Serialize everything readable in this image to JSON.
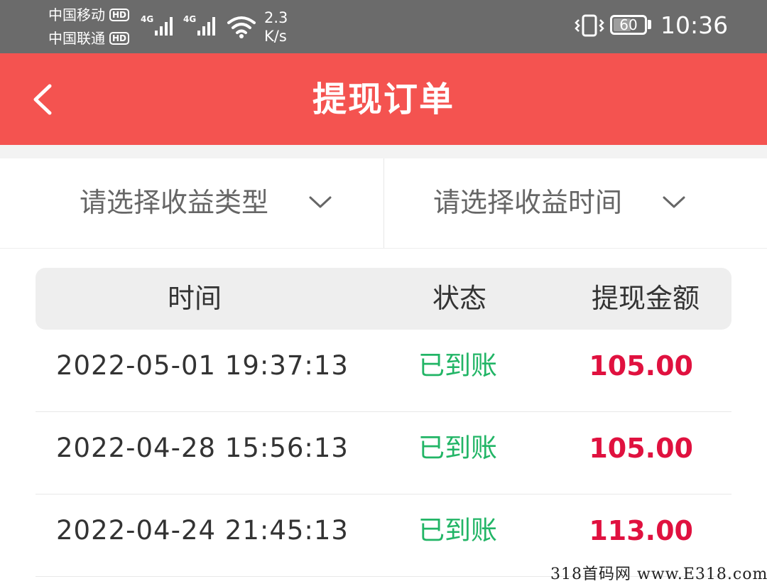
{
  "status_bar": {
    "carrier1": "中国移动",
    "carrier2": "中国联通",
    "hd_badge": "HD",
    "network1": "4G",
    "network2": "4G",
    "speed_value": "2.3",
    "speed_unit": "K/s",
    "battery": "60",
    "battery_level": 0.6,
    "time": "10:36"
  },
  "header": {
    "title": "提现订单",
    "back_icon": "chevron-left-icon",
    "background": "#f45350"
  },
  "filters": [
    {
      "label": "请选择收益类型",
      "icon": "chevron-down-icon"
    },
    {
      "label": "请选择收益时间",
      "icon": "chevron-down-icon"
    }
  ],
  "table": {
    "columns": [
      "时间",
      "状态",
      "提现金额"
    ],
    "rows": [
      {
        "time": "2022-05-01 19:37:13",
        "status": "已到账",
        "amount": "105.00"
      },
      {
        "time": "2022-04-28 15:56:13",
        "status": "已到账",
        "amount": "105.00"
      },
      {
        "time": "2022-04-24 21:45:13",
        "status": "已到账",
        "amount": "113.00"
      }
    ],
    "status_color": "#22b566",
    "amount_color": "#e0113f"
  },
  "watermark": "318首码网  www.E318.com"
}
